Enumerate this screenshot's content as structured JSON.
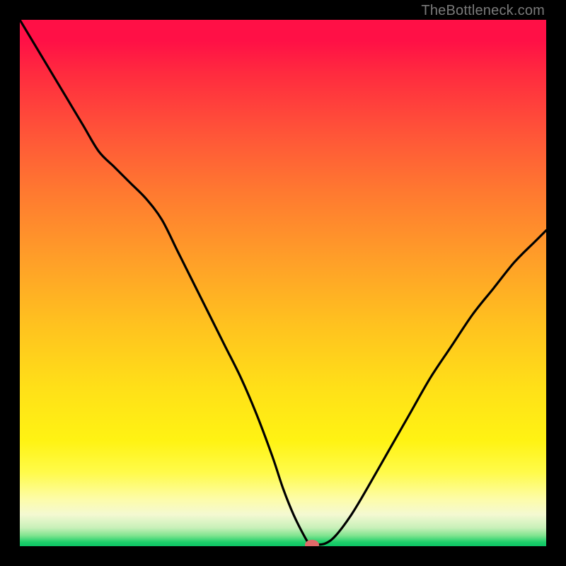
{
  "watermark": "TheBottleneck.com",
  "colors": {
    "frame": "#000000",
    "curve": "#000000",
    "marker": "#e06a6a"
  },
  "chart_data": {
    "type": "line",
    "title": "",
    "xlabel": "",
    "ylabel": "",
    "xlim": [
      0,
      100
    ],
    "ylim": [
      0,
      100
    ],
    "grid": false,
    "legend": false,
    "series": [
      {
        "name": "bottleneck-curve",
        "x": [
          0,
          3,
          6,
          9,
          12,
          15,
          18,
          21,
          24,
          27,
          30,
          33,
          36,
          39,
          42,
          45,
          48,
          50,
          52,
          54,
          55,
          56,
          58,
          60,
          63,
          66,
          70,
          74,
          78,
          82,
          86,
          90,
          94,
          98,
          100
        ],
        "y": [
          100,
          95,
          90,
          85,
          80,
          75,
          72,
          69,
          66,
          62,
          56,
          50,
          44,
          38,
          32,
          25,
          17,
          11,
          6,
          2,
          0.5,
          0.3,
          0.5,
          2,
          6,
          11,
          18,
          25,
          32,
          38,
          44,
          49,
          54,
          58,
          60
        ]
      }
    ],
    "marker": {
      "x": 55.5,
      "y": 0.3
    },
    "gradient_stops": [
      {
        "pos": 0,
        "color": "#ff1046"
      },
      {
        "pos": 0.22,
        "color": "#ff5638"
      },
      {
        "pos": 0.46,
        "color": "#ffa028"
      },
      {
        "pos": 0.7,
        "color": "#ffe018"
      },
      {
        "pos": 0.86,
        "color": "#fffb4a"
      },
      {
        "pos": 0.94,
        "color": "#f4f9d2"
      },
      {
        "pos": 0.98,
        "color": "#7fe48f"
      },
      {
        "pos": 1.0,
        "color": "#0cc465"
      }
    ]
  }
}
